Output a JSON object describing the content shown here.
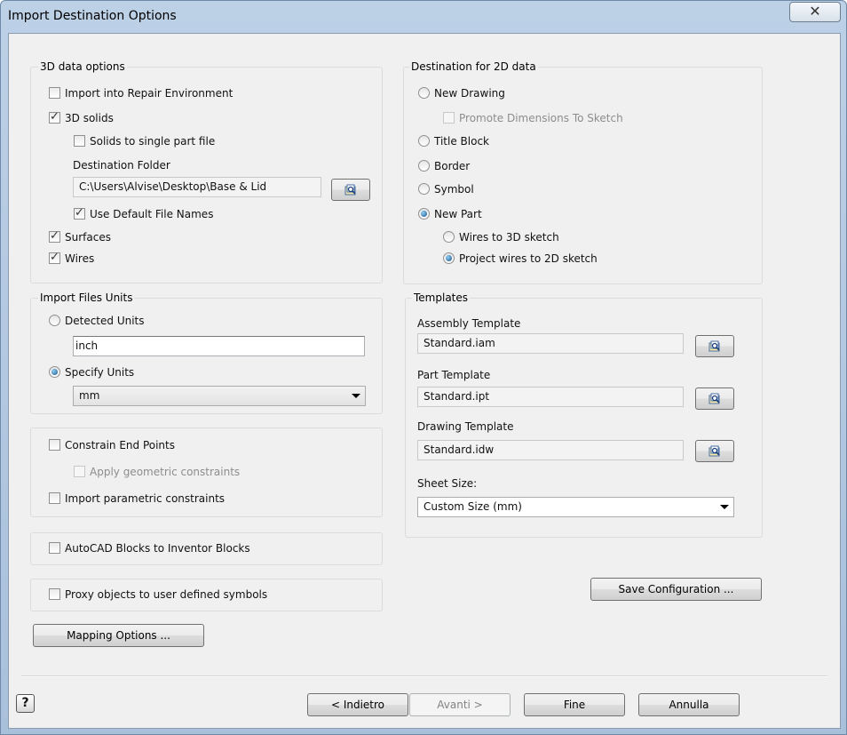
{
  "window": {
    "title": "Import Destination Options",
    "close_glyph": "✕"
  },
  "options_3d": {
    "legend": "3D data options",
    "import_repair": {
      "label": "Import into Repair Environment",
      "checked": false
    },
    "solids": {
      "label": "3D solids",
      "checked": true
    },
    "single_part": {
      "label": "Solids to single part file",
      "checked": false
    },
    "dest_folder_label": "Destination Folder",
    "dest_folder_value": "C:\\Users\\Alvise\\Desktop\\Base & Lid",
    "default_names": {
      "label": "Use Default File Names",
      "checked": true
    },
    "surfaces": {
      "label": "Surfaces",
      "checked": true
    },
    "wires": {
      "label": "Wires",
      "checked": true
    }
  },
  "units": {
    "legend": "Import Files Units",
    "detected": {
      "label": "Detected Units",
      "selected": false
    },
    "detected_value": "inch",
    "specify": {
      "label": "Specify Units",
      "selected": true
    },
    "specify_value": "mm"
  },
  "constraints": {
    "end_points": {
      "label": "Constrain End Points",
      "checked": false
    },
    "geometric": {
      "label": "Apply geometric constraints",
      "checked": false,
      "disabled": true
    },
    "parametric": {
      "label": "Import parametric constraints",
      "checked": false
    }
  },
  "autocad_blocks": {
    "label": "AutoCAD Blocks to Inventor Blocks",
    "checked": false
  },
  "proxy_objects": {
    "label": "Proxy objects to user defined symbols",
    "checked": false
  },
  "mapping_button": "Mapping Options ...",
  "dest_2d": {
    "legend": "Destination for 2D data",
    "new_drawing": {
      "label": "New Drawing",
      "selected": false
    },
    "promote_dims": {
      "label": "Promote Dimensions To Sketch",
      "checked": false,
      "disabled": true
    },
    "title_block": {
      "label": "Title Block",
      "selected": false
    },
    "border": {
      "label": "Border",
      "selected": false
    },
    "symbol": {
      "label": "Symbol",
      "selected": false
    },
    "new_part": {
      "label": "New Part",
      "selected": true
    },
    "wires_3d": {
      "label": "Wires to 3D sketch",
      "selected": false
    },
    "project_2d": {
      "label": "Project wires to 2D sketch",
      "selected": true
    }
  },
  "templates": {
    "legend": "Templates",
    "assembly_label": "Assembly Template",
    "assembly_value": "Standard.iam",
    "part_label": "Part Template",
    "part_value": "Standard.ipt",
    "drawing_label": "Drawing Template",
    "drawing_value": "Standard.idw",
    "sheet_label": "Sheet Size:",
    "sheet_value": "Custom Size (mm)"
  },
  "save_config_button": "Save Configuration ...",
  "footer": {
    "help_glyph": "?",
    "back": "< Indietro",
    "next": "Avanti >",
    "finish": "Fine",
    "cancel": "Annulla"
  },
  "icons": {
    "browse": "folder-browse-icon",
    "help": "help-icon",
    "close": "close-icon",
    "dropdown": "chevron-down-icon"
  }
}
